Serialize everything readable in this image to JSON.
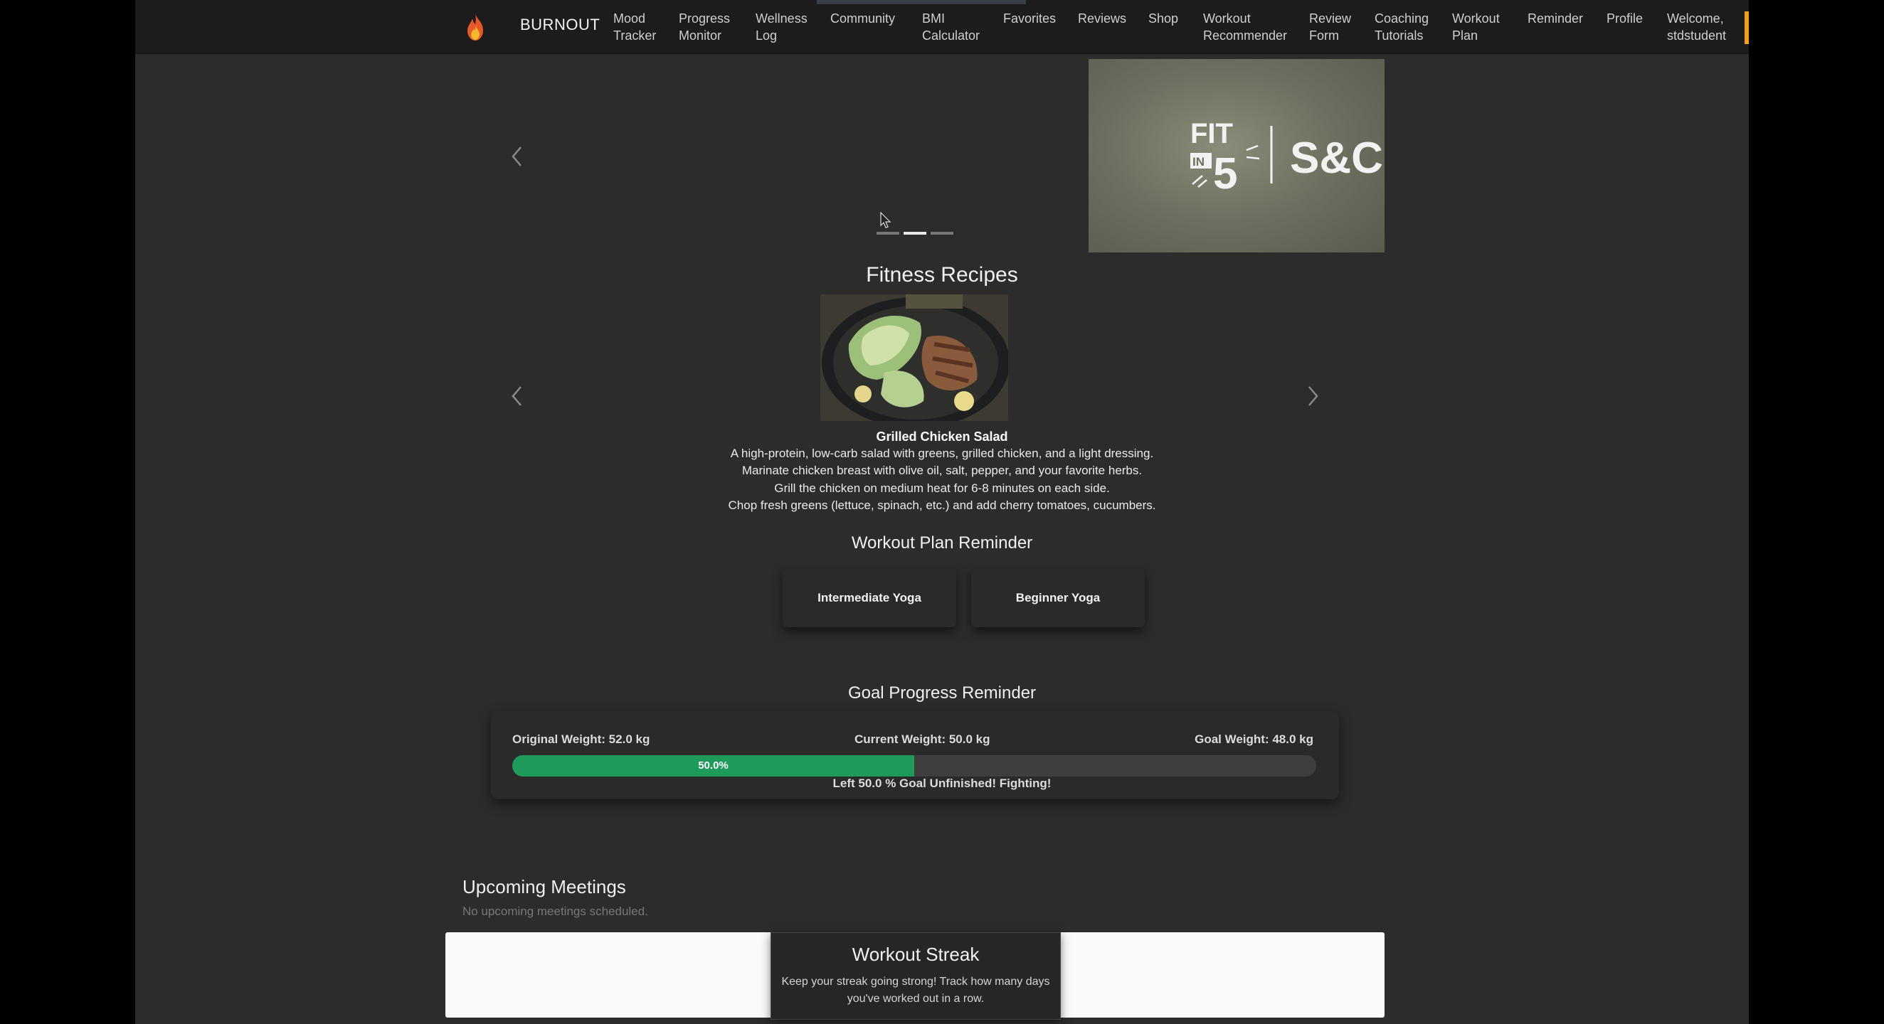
{
  "navbar": {
    "brand": "BURNOUT",
    "items": [
      {
        "label": "Mood\nTracker"
      },
      {
        "label": "Progress\nMonitor"
      },
      {
        "label": "Wellness\nLog"
      },
      {
        "label": "Community"
      },
      {
        "label": "BMI\nCalculator"
      },
      {
        "label": "Favorites"
      },
      {
        "label": "Reviews"
      },
      {
        "label": "Shop"
      },
      {
        "label": "Workout\nRecommender"
      },
      {
        "label": "Review\nForm"
      },
      {
        "label": "Coaching\nTutorials"
      },
      {
        "label": "Workout\nPlan"
      },
      {
        "label": "Reminder"
      },
      {
        "label": "Profile"
      },
      {
        "label": "Welcome,\nstdstudent"
      }
    ]
  },
  "banner": {
    "logo_left_text": "FIT IN 5",
    "logo_right_text": "S&C",
    "active_slide": 1,
    "slide_count": 3
  },
  "recipes": {
    "section_title": "Fitness Recipes",
    "name": "Grilled Chicken Salad",
    "lines": [
      "A high-protein, low-carb salad with greens, grilled chicken, and a light dressing.",
      "Marinate chicken breast with olive oil, salt, pepper, and your favorite herbs.",
      "Grill the chicken on medium heat for 6-8 minutes on each side.",
      "Chop fresh greens (lettuce, spinach, etc.) and add cherry tomatoes, cucumbers."
    ]
  },
  "workout_plan": {
    "title": "Workout Plan Reminder",
    "plans": [
      "Intermediate Yoga",
      "Beginner Yoga"
    ]
  },
  "goal": {
    "title": "Goal Progress Reminder",
    "original": "Original Weight: 52.0 kg",
    "current": "Current Weight: 50.0 kg",
    "target": "Goal Weight: 48.0 kg",
    "progress_percent": 50,
    "progress_label": "50.0%",
    "message": "Left 50.0 % Goal Unfinished! Fighting!",
    "fill_color": "#1e9a5a"
  },
  "meetings": {
    "title": "Upcoming Meetings",
    "empty": "No upcoming meetings scheduled."
  },
  "streak": {
    "title": "Workout Streak",
    "text": "Keep your streak going strong! Track how many days you've worked out in a row."
  },
  "colors": {
    "page_bg": "#2c2c2c",
    "nav_bg": "#1c1c1c",
    "accent": "#f0a020"
  }
}
